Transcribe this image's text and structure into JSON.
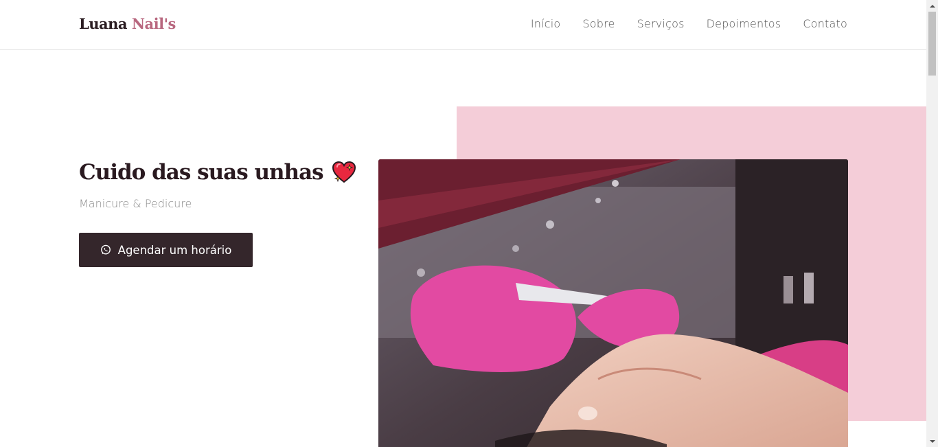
{
  "header": {
    "logo_part1": "Luana",
    "logo_part2": "Nail's",
    "nav": [
      "Início",
      "Sobre",
      "Serviços",
      "Depoimentos",
      "Contato"
    ]
  },
  "hero": {
    "title": "Cuido das suas unhas",
    "title_icon": "sparkling-heart-icon",
    "subtitle": "Manicure & Pedicure",
    "cta_label": "Agendar um horário",
    "cta_icon": "whatsapp-icon",
    "image_icon": "manicure-photo"
  },
  "colors": {
    "accent": "#b8677f",
    "pink_block": "#f4cdd8",
    "button": "#34262b",
    "title": "#2a1a20"
  }
}
